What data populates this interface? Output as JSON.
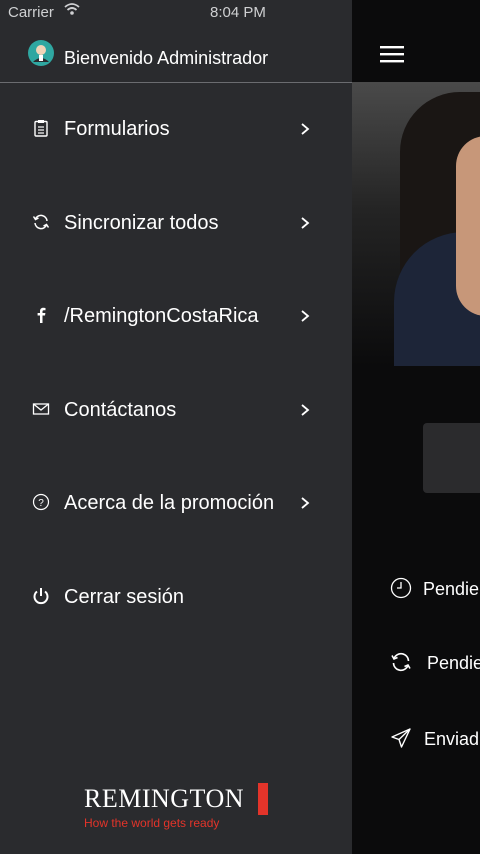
{
  "status_bar": {
    "carrier": "Carrier",
    "time": "8:04 PM"
  },
  "drawer": {
    "welcome": "Bienvenido Administrador",
    "items": [
      {
        "label": "Formularios",
        "icon": "clipboard-icon",
        "chevron": true
      },
      {
        "label": "Sincronizar todos",
        "icon": "sync-icon",
        "chevron": true
      },
      {
        "label": "/RemingtonCostaRica",
        "icon": "facebook-icon",
        "chevron": true
      },
      {
        "label": "Contáctanos",
        "icon": "envelope-icon",
        "chevron": true
      },
      {
        "label": "Acerca de la promoción",
        "icon": "question-circle-icon",
        "chevron": true
      },
      {
        "label": "Cerrar sesión",
        "icon": "power-icon",
        "chevron": false
      }
    ],
    "logo": {
      "brand": "REMINGTON",
      "tagline": "How the world gets ready"
    }
  },
  "background_app": {
    "rows": [
      {
        "text": "Pendie",
        "icon": "clock-icon"
      },
      {
        "text": "Pendie",
        "icon": "sync-icon"
      },
      {
        "text": "Enviad",
        "icon": "paper-plane-icon"
      }
    ]
  },
  "colors": {
    "drawer_bg": "#2a2b2e",
    "brand_red": "#e3342a",
    "divider": "#6b6c70"
  }
}
